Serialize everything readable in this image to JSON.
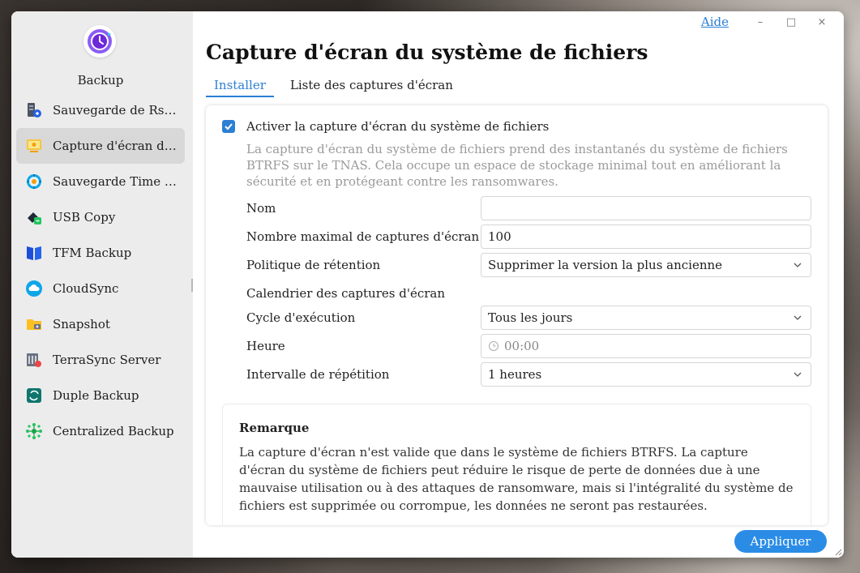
{
  "app": {
    "name": "Backup"
  },
  "window": {
    "help_label": "Aide",
    "minimize_glyph": "–",
    "maximize_glyph": "□",
    "close_glyph": "×"
  },
  "sidebar": {
    "items": [
      {
        "label": "Sauvegarde de Rsync",
        "icon": "rsync-icon",
        "active": false
      },
      {
        "label": "Capture d'écran du système de fichiers",
        "icon": "snapshot-screen-icon",
        "active": true
      },
      {
        "label": "Sauvegarde Time Machine",
        "icon": "time-machine-icon",
        "active": false
      },
      {
        "label": "USB Copy",
        "icon": "usb-copy-icon",
        "active": false
      },
      {
        "label": "TFM Backup",
        "icon": "tfm-book-icon",
        "active": false
      },
      {
        "label": "CloudSync",
        "icon": "cloudsync-icon",
        "active": false
      },
      {
        "label": "Snapshot",
        "icon": "folder-camera-icon",
        "active": false
      },
      {
        "label": "TerraSync Server",
        "icon": "terrasync-icon",
        "active": false
      },
      {
        "label": "Duple Backup",
        "icon": "duple-backup-icon",
        "active": false
      },
      {
        "label": "Centralized Backup",
        "icon": "centralized-backup-icon",
        "active": false
      }
    ]
  },
  "main": {
    "title": "Capture d'écran du système de fichiers",
    "tabs": [
      {
        "label": "Installer",
        "active": true
      },
      {
        "label": "Liste des captures d'écran",
        "active": false
      }
    ],
    "enable_label": "Activer la capture d'écran du système de fichiers",
    "enable_checked": true,
    "description": "La capture d'écran du système de fichiers prend des instantanés du système de fichiers BTRFS sur le TNAS. Cela occupe un espace de stockage minimal tout en améliorant la sécurité et en protégeant contre les ransomwares.",
    "fields": {
      "name_label": "Nom",
      "name_value": "",
      "max_label": "Nombre maximal de captures d'écran",
      "max_value": "100",
      "retention_label": "Politique de rétention",
      "retention_value": "Supprimer la version la plus ancienne",
      "schedule_label": "Calendrier des captures d'écran",
      "cycle_label": "Cycle d'exécution",
      "cycle_value": "Tous les jours",
      "time_label": "Heure",
      "time_value": "00:00",
      "interval_label": "Intervalle de répétition",
      "interval_value": "1 heures"
    },
    "note": {
      "title": "Remarque",
      "text": "La capture d'écran n'est valide que dans le système de fichiers BTRFS. La capture d'écran du système de fichiers peut réduire le risque de perte de données due à une mauvaise utilisation ou à des attaques de ransomware, mais si l'intégralité du système de fichiers est supprimée ou corrompue, les données ne seront pas restaurées."
    },
    "apply_label": "Appliquer"
  },
  "colors": {
    "accent": "#2b7fd4",
    "apply_button": "#2b8ce6",
    "sidebar_bg": "#ececec",
    "sidebar_active": "#d8d8d8"
  }
}
